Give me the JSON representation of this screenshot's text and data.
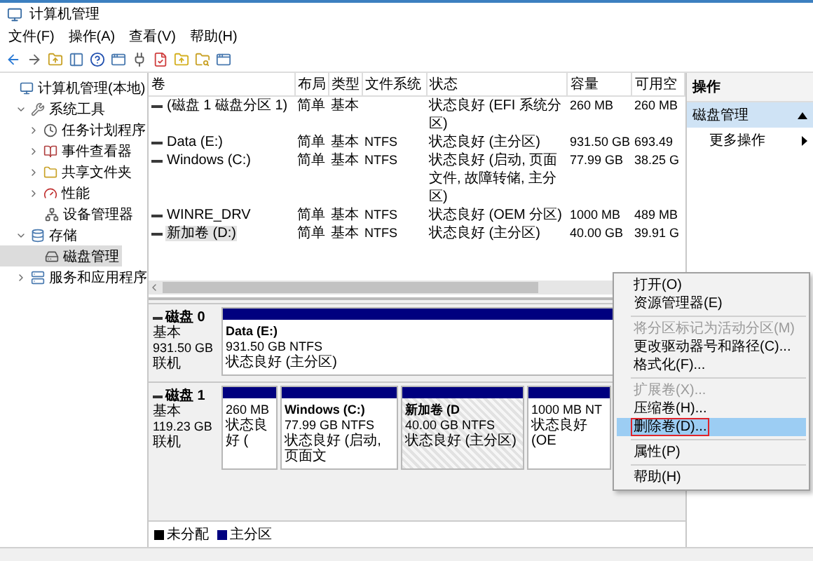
{
  "window": {
    "title": "计算机管理"
  },
  "menu_bar": [
    "文件(F)",
    "操作(A)",
    "查看(V)",
    "帮助(H)"
  ],
  "tree": [
    {
      "label": "计算机管理(本地)",
      "selected": false,
      "children": [
        {
          "label": "系统工具",
          "expanded": true,
          "selected": false,
          "children": [
            {
              "label": "任务计划程序",
              "expanded": false,
              "selected": false
            },
            {
              "label": "事件查看器",
              "expanded": false,
              "selected": false
            },
            {
              "label": "共享文件夹",
              "expanded": false,
              "selected": false
            },
            {
              "label": "性能",
              "expanded": false,
              "selected": false
            },
            {
              "label": "设备管理器",
              "selected": false
            }
          ]
        },
        {
          "label": "存储",
          "expanded": true,
          "selected": false,
          "children": [
            {
              "label": "磁盘管理",
              "selected": true
            }
          ]
        },
        {
          "label": "服务和应用程序",
          "expanded": false,
          "selected": false
        }
      ]
    }
  ],
  "volume_table": {
    "columns": [
      "卷",
      "布局",
      "类型",
      "文件系统",
      "状态",
      "容量",
      "可用空"
    ],
    "rows": [
      {
        "volume": "(磁盘 1 磁盘分区 1)",
        "layout": "简单",
        "type": "基本",
        "status": "状态良好 (EFI 系统分区)",
        "capacity": "260 MB",
        "free": "260 MB",
        "selected": false
      },
      {
        "volume": "Data (E:)",
        "layout": "简单",
        "type": "基本",
        "file_system": "NTFS",
        "status": "状态良好 (主分区)",
        "capacity": "931.50 GB",
        "free": "693.49",
        "selected": false
      },
      {
        "volume": "Windows (C:)",
        "layout": "简单",
        "type": "基本",
        "file_system": "NTFS",
        "status": "状态良好 (启动, 页面文件, 故障转储, 主分区)",
        "capacity": "77.99 GB",
        "free": "38.25 G",
        "selected": false
      },
      {
        "volume": "WINRE_DRV",
        "layout": "简单",
        "type": "基本",
        "file_system": "NTFS",
        "status": "状态良好 (OEM 分区)",
        "capacity": "1000 MB",
        "free": "489 MB",
        "selected": false
      },
      {
        "volume": "新加卷 (D:)",
        "layout": "简单",
        "type": "基本",
        "file_system": "NTFS",
        "status": "状态良好 (主分区)",
        "capacity": "40.00 GB",
        "free": "39.91 G",
        "selected": true
      }
    ]
  },
  "disks": [
    {
      "label": "磁盘 0",
      "type": "基本",
      "size": "931.50 GB",
      "status": "联机",
      "partitions": [
        {
          "name": "Data  (E:)",
          "size": "931.50 GB NTFS",
          "status": "状态良好 (主分区)",
          "selected": false
        }
      ]
    },
    {
      "label": "磁盘 1",
      "type": "基本",
      "size": "119.23 GB",
      "status": "联机",
      "partitions": [
        {
          "size": "260 MB",
          "status": "状态良好 (",
          "selected": false
        },
        {
          "name": "Windows  (C:)",
          "size": "77.99 GB NTFS",
          "status": "状态良好 (启动, 页面文",
          "selected": false
        },
        {
          "name": "新加卷  (D",
          "size": "40.00 GB NTFS",
          "status": "状态良好 (主分区)",
          "selected": true
        },
        {
          "size": "1000 MB NT",
          "status": "状态良好 (OE",
          "selected": false
        }
      ]
    }
  ],
  "legend": [
    {
      "label": "未分配",
      "color": "#000000"
    },
    {
      "label": "主分区",
      "color": "#000080"
    }
  ],
  "context_menu": {
    "items": [
      {
        "kind": "item",
        "label": "打开(O)",
        "disabled": false,
        "selected": false
      },
      {
        "kind": "item",
        "label": "资源管理器(E)",
        "disabled": false,
        "selected": false
      },
      {
        "kind": "separator"
      },
      {
        "kind": "item",
        "label": "将分区标记为活动分区(M)",
        "disabled": true,
        "selected": false
      },
      {
        "kind": "item",
        "label": "更改驱动器号和路径(C)...",
        "disabled": false,
        "selected": false
      },
      {
        "kind": "item",
        "label": "格式化(F)...",
        "disabled": false,
        "selected": false
      },
      {
        "kind": "separator"
      },
      {
        "kind": "item",
        "label": "扩展卷(X)...",
        "disabled": true,
        "selected": false
      },
      {
        "kind": "item",
        "label": "压缩卷(H)...",
        "disabled": false,
        "selected": false
      },
      {
        "kind": "item",
        "label": "删除卷(D)...",
        "disabled": false,
        "selected": true
      },
      {
        "kind": "separator"
      },
      {
        "kind": "item",
        "label": "属性(P)",
        "disabled": false,
        "selected": false
      },
      {
        "kind": "separator"
      },
      {
        "kind": "item",
        "label": "帮助(H)",
        "disabled": false,
        "selected": false
      }
    ]
  },
  "actions": {
    "title": "操作",
    "sections": [
      {
        "label": "磁盘管理",
        "expanded": true,
        "items": [
          "更多操作"
        ]
      }
    ]
  }
}
